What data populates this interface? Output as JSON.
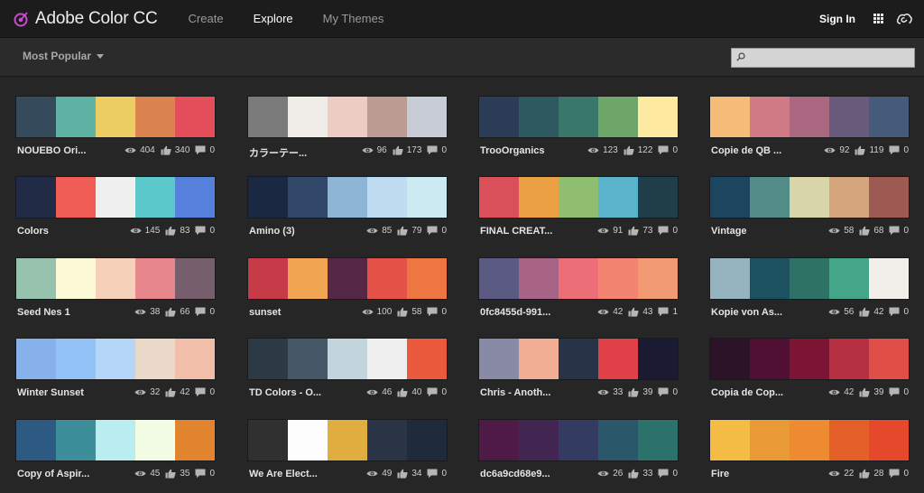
{
  "header": {
    "app_title": "Adobe Color CC",
    "nav": [
      {
        "label": "Create",
        "active": false
      },
      {
        "label": "Explore",
        "active": true
      },
      {
        "label": "My Themes",
        "active": false
      }
    ],
    "sign_in": "Sign In"
  },
  "filter": {
    "sort_label": "Most Popular",
    "search_placeholder": ""
  },
  "themes": [
    {
      "name": "NOUEBO Ori...",
      "views": "404",
      "likes": "340",
      "comments": "0",
      "colors": [
        "#354b5b",
        "#5fb3a4",
        "#ebcd63",
        "#dc8450",
        "#e44d5a"
      ]
    },
    {
      "name": "カラーテー...",
      "views": "96",
      "likes": "173",
      "comments": "0",
      "colors": [
        "#7a7a7a",
        "#f0ede8",
        "#edccc4",
        "#bc9c92",
        "#c7ccd6"
      ]
    },
    {
      "name": "TrooOrganics",
      "views": "123",
      "likes": "122",
      "comments": "0",
      "colors": [
        "#2b3d56",
        "#2d5a60",
        "#3a776b",
        "#6ea66a",
        "#fdeaa0"
      ]
    },
    {
      "name": "Copie de QB ...",
      "views": "92",
      "likes": "119",
      "comments": "0",
      "colors": [
        "#f4bc76",
        "#cf7a84",
        "#a9687f",
        "#675a7b",
        "#465a79"
      ]
    },
    {
      "name": "Colors",
      "views": "145",
      "likes": "83",
      "comments": "0",
      "colors": [
        "#222b45",
        "#ef5d55",
        "#f0f0f0",
        "#5bc9cc",
        "#5581dc"
      ]
    },
    {
      "name": "Amino (3)",
      "views": "85",
      "likes": "79",
      "comments": "0",
      "colors": [
        "#1b2841",
        "#32486b",
        "#8eb5d6",
        "#bfdcf0",
        "#cbeaf2"
      ]
    },
    {
      "name": "FINAL CREAT...",
      "views": "91",
      "likes": "73",
      "comments": "0",
      "colors": [
        "#d9505a",
        "#eba043",
        "#8fbe70",
        "#59b3ca",
        "#203e49"
      ]
    },
    {
      "name": "Vintage",
      "views": "58",
      "likes": "68",
      "comments": "0",
      "colors": [
        "#1c4560",
        "#518c86",
        "#d8d6a8",
        "#d5a67c",
        "#9c5a52"
      ]
    },
    {
      "name": "Seed Nes 1",
      "views": "38",
      "likes": "66",
      "comments": "0",
      "colors": [
        "#97c2ae",
        "#fdfad7",
        "#f6d0b8",
        "#e7878d",
        "#775e6c"
      ]
    },
    {
      "name": "sunset",
      "views": "100",
      "likes": "58",
      "comments": "0",
      "colors": [
        "#c73a48",
        "#f1a452",
        "#562645",
        "#e35147",
        "#ee7640"
      ]
    },
    {
      "name": "0fc8455d-991...",
      "views": "42",
      "likes": "43",
      "comments": "1",
      "colors": [
        "#5b5a84",
        "#a86484",
        "#ec6e77",
        "#f38470",
        "#f29a72"
      ]
    },
    {
      "name": "Kopie von As...",
      "views": "56",
      "likes": "42",
      "comments": "0",
      "colors": [
        "#96b3c0",
        "#1c5160",
        "#2e7265",
        "#43a689",
        "#f2efeb"
      ]
    },
    {
      "name": "Winter Sunset",
      "views": "32",
      "likes": "42",
      "comments": "0",
      "colors": [
        "#86b1ea",
        "#93c3f6",
        "#b4d6f7",
        "#ead8c8",
        "#f1beaa"
      ]
    },
    {
      "name": "TD Colors - O...",
      "views": "46",
      "likes": "40",
      "comments": "0",
      "colors": [
        "#2b3a45",
        "#445868",
        "#c2d4dc",
        "#efefef",
        "#ec5a3e"
      ]
    },
    {
      "name": "Chris - Anoth...",
      "views": "33",
      "likes": "39",
      "comments": "0",
      "colors": [
        "#888aa6",
        "#f2ae94",
        "#273447",
        "#e04148",
        "#1a1b33"
      ]
    },
    {
      "name": "Copia de Cop...",
      "views": "42",
      "likes": "39",
      "comments": "0",
      "colors": [
        "#2c1328",
        "#4f1033",
        "#7c1534",
        "#b53040",
        "#df4f48"
      ]
    },
    {
      "name": "Copy of Aspir...",
      "views": "45",
      "likes": "35",
      "comments": "0",
      "colors": [
        "#2d5a82",
        "#3c8e9a",
        "#b9edf0",
        "#f3fde4",
        "#e2832e"
      ]
    },
    {
      "name": "We Are Elect...",
      "views": "49",
      "likes": "34",
      "comments": "0",
      "colors": [
        "#303030",
        "#fdfdfd",
        "#e0ae3f",
        "#2b3347",
        "#202a3d"
      ]
    },
    {
      "name": "dc6a9cd68e9...",
      "views": "26",
      "likes": "33",
      "comments": "0",
      "colors": [
        "#501a47",
        "#422553",
        "#343b63",
        "#2a576a",
        "#2b716c"
      ]
    },
    {
      "name": "Fire",
      "views": "22",
      "likes": "28",
      "comments": "0",
      "colors": [
        "#f4bc44",
        "#e99a36",
        "#ee8a2f",
        "#e46028",
        "#e5482a"
      ]
    }
  ]
}
